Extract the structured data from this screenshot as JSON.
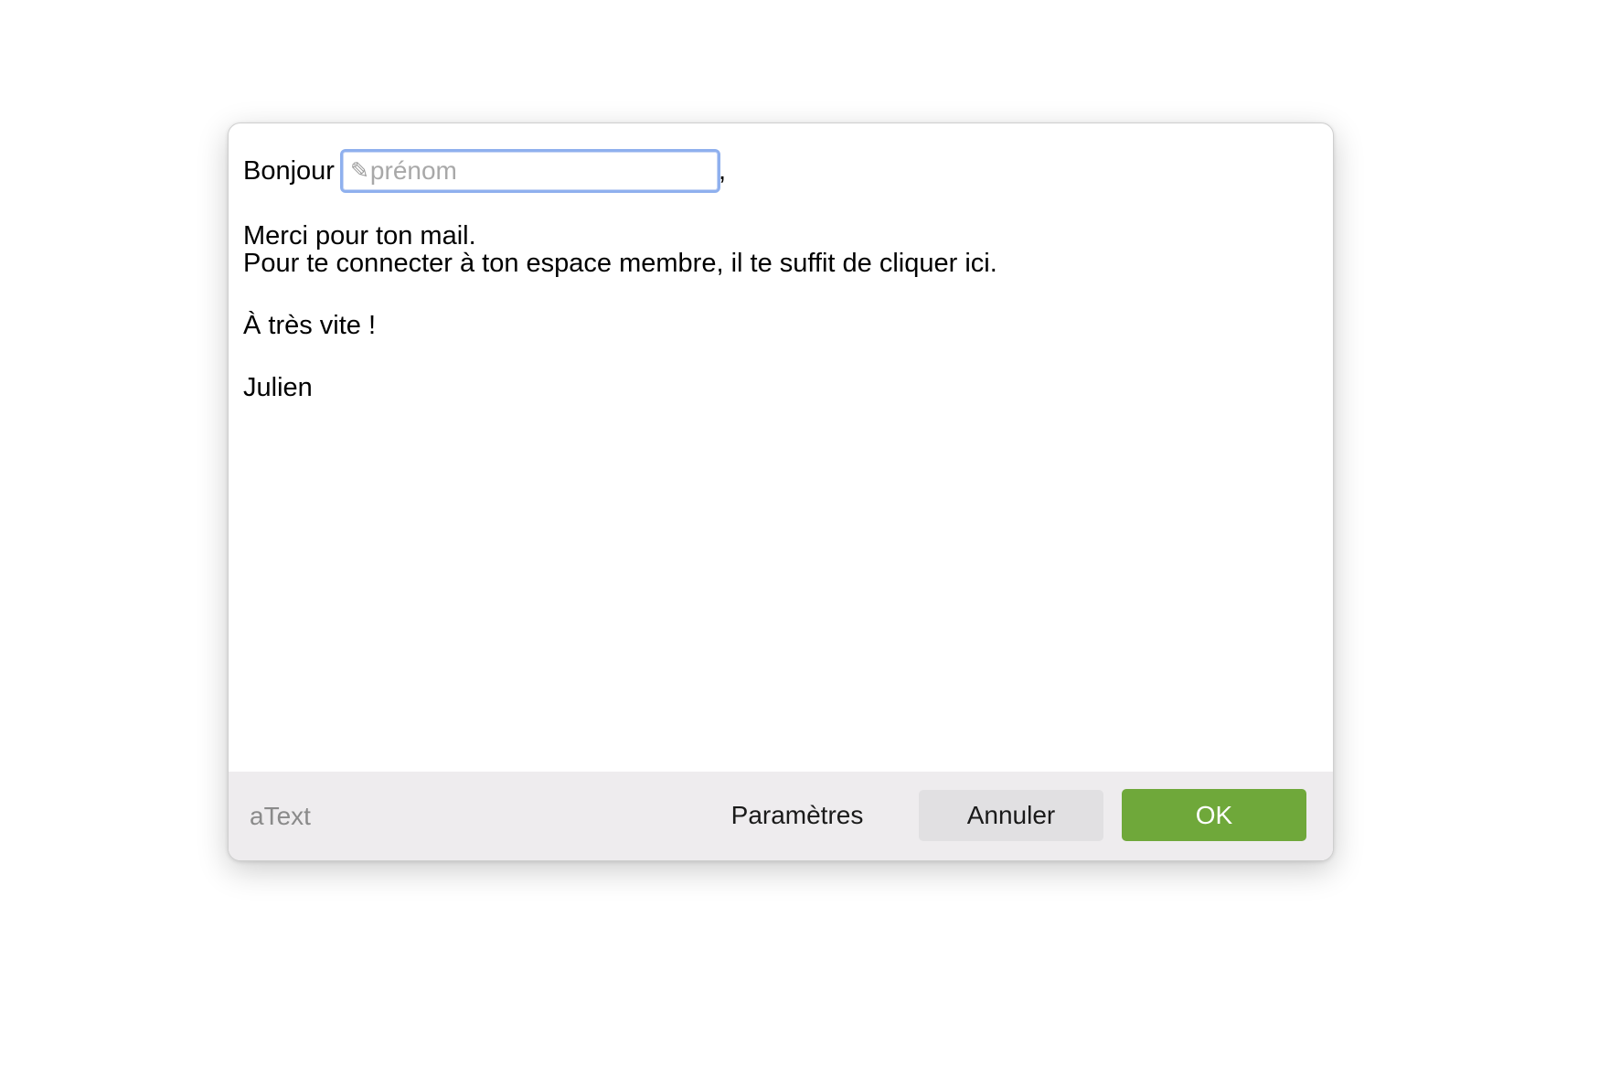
{
  "snippet": {
    "greeting_prefix": "Bonjour",
    "field": {
      "icon": "pencil-icon",
      "placeholder": "prénom",
      "value": ""
    },
    "greeting_suffix": ",",
    "line1": "Merci pour ton mail.",
    "line2": "Pour te connecter à ton espace membre, il te suffit de cliquer ici.",
    "line3": "À très vite !",
    "signature": "Julien"
  },
  "footer": {
    "brand": "aText",
    "settings_label": "Paramètres",
    "cancel_label": "Annuler",
    "ok_label": "OK"
  },
  "colors": {
    "ok_button": "#6fa83a",
    "field_focus_ring": "#8fb0ee",
    "footer_background": "#eeecee"
  }
}
